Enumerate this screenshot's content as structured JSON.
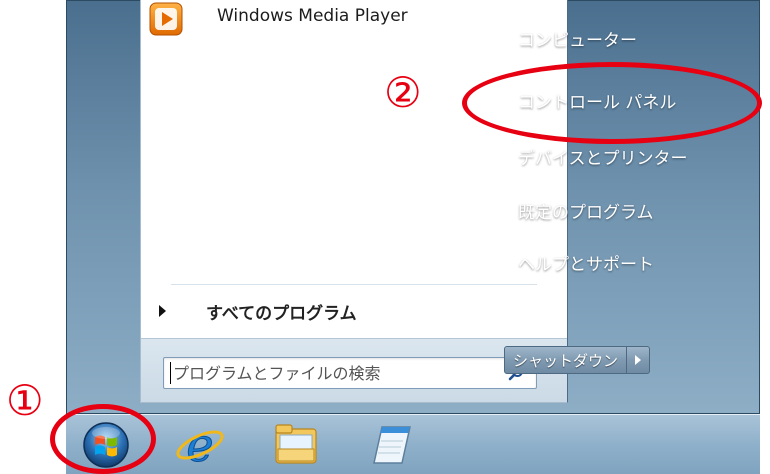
{
  "start_menu": {
    "pinned": [
      {
        "label": "Windows Media Player",
        "icon": "media-player-icon"
      }
    ],
    "all_programs_label": "すべてのプログラム",
    "search_placeholder": "プログラムとファイルの検索",
    "right_items": [
      {
        "label": "コンピューター"
      },
      {
        "label": "コントロール パネル"
      },
      {
        "label": "デバイスとプリンター"
      },
      {
        "label": "既定のプログラム"
      },
      {
        "label": "ヘルプとサポート"
      }
    ],
    "shutdown_label": "シャットダウン"
  },
  "taskbar": {
    "items": [
      {
        "icon": "windows-start-orb-icon"
      },
      {
        "icon": "internet-explorer-icon"
      },
      {
        "icon": "file-explorer-icon"
      },
      {
        "icon": "notepad-icon"
      }
    ]
  },
  "annotations": {
    "step1": "①",
    "step2": "②",
    "color": "#e60012"
  }
}
